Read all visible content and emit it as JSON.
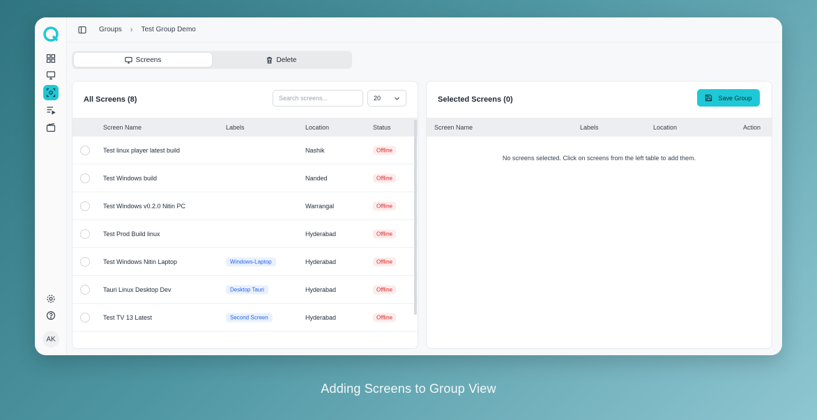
{
  "breadcrumb": {
    "parent": "Groups",
    "current": "Test Group Demo"
  },
  "tabs": [
    {
      "label": "Screens",
      "icon": "monitor-icon",
      "active": true
    },
    {
      "label": "Delete",
      "icon": "trash-icon",
      "active": false
    }
  ],
  "left_panel": {
    "title": "All Screens (8)",
    "search_placeholder": "Search screens...",
    "page_size": "20",
    "columns": {
      "name": "Screen Name",
      "labels": "Labels",
      "location": "Location",
      "status": "Status"
    },
    "rows": [
      {
        "name": "Test linux player latest build",
        "label": "",
        "location": "Nashik",
        "status": "Offline"
      },
      {
        "name": "Test Windows build",
        "label": "",
        "location": "Nanded",
        "status": "Offline"
      },
      {
        "name": "Test Windows v0.2.0 Nitin PC",
        "label": "",
        "location": "Warrangal",
        "status": "Offline"
      },
      {
        "name": "Test Prod Build linux",
        "label": "",
        "location": "Hyderabad",
        "status": "Offline"
      },
      {
        "name": "Test Windows Nitin Laptop",
        "label": "Windows-Laptop",
        "location": "Hyderabad",
        "status": "Offline"
      },
      {
        "name": "Tauri Linux Desktop Dev",
        "label": "Desktop Tauri",
        "location": "Hyderabad",
        "status": "Offline"
      },
      {
        "name": "Test TV 13 Latest",
        "label": "Second Screen",
        "location": "Hyderabad",
        "status": "Offline"
      }
    ]
  },
  "right_panel": {
    "title": "Selected Screens (0)",
    "save_label": "Save Group",
    "columns": {
      "name": "Screen Name",
      "labels": "Labels",
      "location": "Location",
      "action": "Action"
    },
    "empty_message": "No screens selected. Click on screens from the left table to add them."
  },
  "user": {
    "initials": "AK"
  },
  "caption": "Adding Screens to Group View",
  "colors": {
    "accent": "#1ec8d6",
    "offline": "#dc2626",
    "label_chip": "#2563eb"
  }
}
